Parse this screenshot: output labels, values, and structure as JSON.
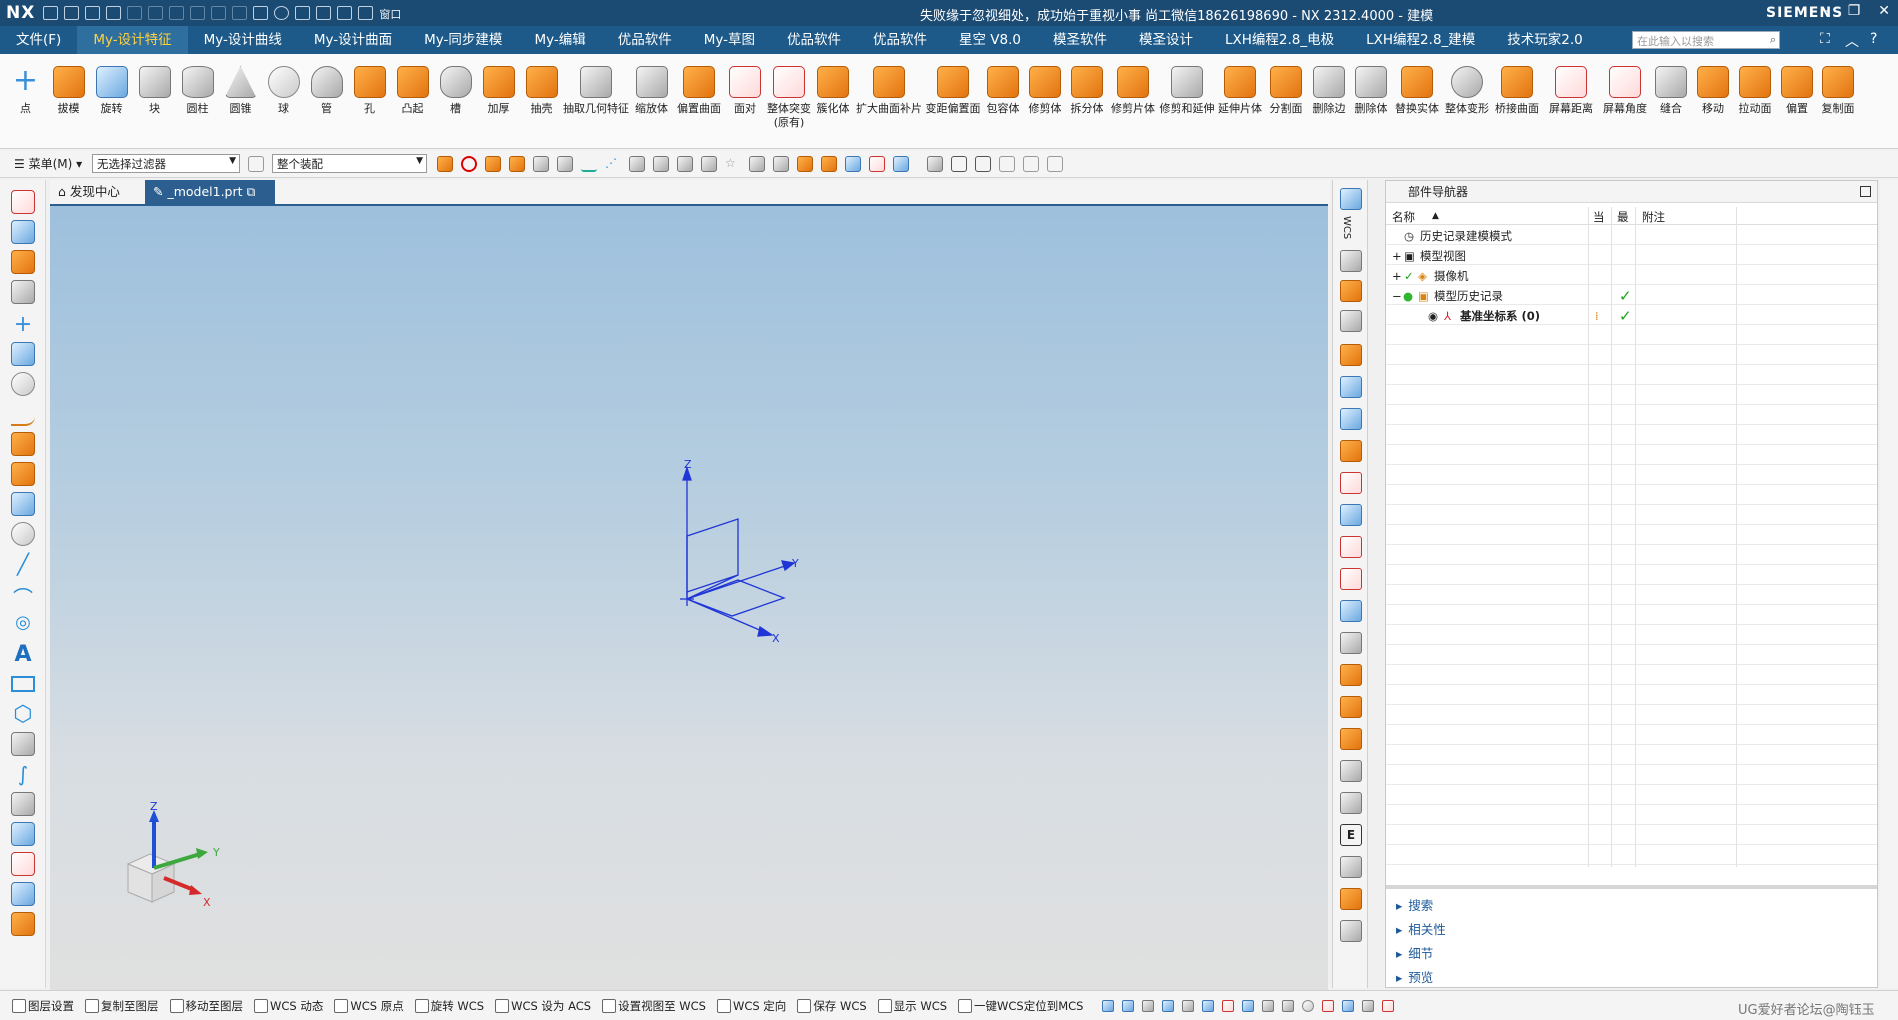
{
  "titlebar": {
    "logo": "NX",
    "title": "失败缘于忽视细处，成功始于重视小事   尚工微信18626198690 - NX 2312.4000 - 建模",
    "brand": "SIEMENS",
    "window_label": "窗口"
  },
  "menubar": {
    "items": [
      "文件(F)",
      "My-设计特征",
      "My-设计曲线",
      "My-设计曲面",
      "My-同步建模",
      "My-编辑",
      "优品软件",
      "My-草图",
      "优品软件",
      "优品软件",
      "星空 V8.0",
      "模圣软件",
      "模圣设计",
      "LXH编程2.8_电极",
      "LXH编程2.8_建模",
      "技术玩家2.0"
    ],
    "active_index": 1,
    "search_placeholder": "在此输入以搜索"
  },
  "ribbon": {
    "buttons": [
      {
        "label": "点",
        "icon": "point-icon"
      },
      {
        "label": "拔模",
        "icon": "draft-icon"
      },
      {
        "label": "旋转",
        "icon": "revolve-icon"
      },
      {
        "label": "块",
        "icon": "block-icon"
      },
      {
        "label": "圆柱",
        "icon": "cylinder-icon"
      },
      {
        "label": "圆锥",
        "icon": "cone-icon"
      },
      {
        "label": "球",
        "icon": "sphere-icon"
      },
      {
        "label": "管",
        "icon": "tube-icon"
      },
      {
        "label": "孔",
        "icon": "hole-icon"
      },
      {
        "label": "凸起",
        "icon": "emboss-icon"
      },
      {
        "label": "槽",
        "icon": "groove-icon"
      },
      {
        "label": "加厚",
        "icon": "thicken-icon"
      },
      {
        "label": "抽壳",
        "icon": "shell-icon"
      },
      {
        "label": "抽取几何特征",
        "icon": "extract-geometry-icon"
      },
      {
        "label": "缩放体",
        "icon": "scale-body-icon"
      },
      {
        "label": "偏置曲面",
        "icon": "offset-surface-icon"
      },
      {
        "label": "面对",
        "icon": "face-pair-icon"
      },
      {
        "label": "整体突变",
        "label2": "(原有)",
        "icon": "global-shaping-icon"
      },
      {
        "label": "簇化体",
        "icon": "cluster-body-icon"
      },
      {
        "label": "扩大曲面补片",
        "icon": "enlarge-patch-icon"
      },
      {
        "label": "变距偏置面",
        "icon": "variable-offset-icon"
      },
      {
        "label": "包容体",
        "icon": "bounding-body-icon"
      },
      {
        "label": "修剪体",
        "icon": "trim-body-icon"
      },
      {
        "label": "拆分体",
        "icon": "split-body-icon"
      },
      {
        "label": "修剪片体",
        "icon": "trim-sheet-icon"
      },
      {
        "label": "修剪和延伸",
        "icon": "trim-extend-icon"
      },
      {
        "label": "延伸片体",
        "icon": "extend-sheet-icon"
      },
      {
        "label": "分割面",
        "icon": "divide-face-icon"
      },
      {
        "label": "删除边",
        "icon": "delete-edge-icon"
      },
      {
        "label": "删除体",
        "icon": "delete-body-icon"
      },
      {
        "label": "替换实体",
        "icon": "replace-body-icon"
      },
      {
        "label": "整体变形",
        "icon": "global-deform-icon"
      },
      {
        "label": "桥接曲面",
        "icon": "bridge-surface-icon"
      },
      {
        "label": "屏幕距离",
        "icon": "screen-distance-icon"
      },
      {
        "label": "屏幕角度",
        "icon": "screen-angle-icon"
      },
      {
        "label": "缝合",
        "icon": "sew-icon"
      },
      {
        "label": "移动",
        "icon": "move-icon"
      },
      {
        "label": "拉动面",
        "icon": "pull-face-icon"
      },
      {
        "label": "偏置",
        "icon": "offset-icon"
      },
      {
        "label": "复制面",
        "icon": "copy-face-icon"
      }
    ]
  },
  "selbar": {
    "menu_label": "菜单(M)",
    "filter_value": "无选择过滤器",
    "scope_value": "整个装配"
  },
  "tabs": {
    "items": [
      {
        "label": "发现中心"
      },
      {
        "label": "_model1.prt"
      }
    ]
  },
  "viewport": {
    "datum_labels": {
      "x": "X",
      "y": "Y",
      "z": "Z"
    },
    "triad_labels": {
      "x": "X",
      "y": "Y",
      "z": "Z"
    }
  },
  "rightstrip": {
    "wcs_label": "WCS"
  },
  "navigator": {
    "title": "部件导航器",
    "columns": {
      "name": "名称",
      "current": "当",
      "latest": "最",
      "note": "附注"
    },
    "rows": [
      {
        "label": "历史记录建模模式",
        "latest_check": "",
        "icon": "history-clock-icon"
      },
      {
        "label": "模型视图",
        "latest_check": "",
        "icon": "model-views-icon"
      },
      {
        "label": "摄像机",
        "latest_check": "",
        "icon": "camera-icon"
      },
      {
        "label": "模型历史记录",
        "latest_check": "✓",
        "icon": "model-history-icon"
      },
      {
        "label": "基准坐标系 (0)",
        "latest_check": "✓",
        "icon": "datum-csys-icon"
      }
    ],
    "sections": [
      "搜索",
      "相关性",
      "细节",
      "预览"
    ]
  },
  "statusbar": {
    "items": [
      "图层设置",
      "复制至图层",
      "移动至图层",
      "WCS 动态",
      "WCS 原点",
      "旋转 WCS",
      "WCS 设为 ACS",
      "设置视图至 WCS",
      "WCS 定向",
      "保存 WCS",
      "显示 WCS",
      "一键WCS定位到MCS"
    ],
    "watermark": "UG爱好者论坛@陶钰玉"
  },
  "colors": {
    "titlebar": "#1b4a73",
    "menubar": "#1d5a89",
    "active_menu_text": "#ffd23c",
    "check": "#19a319",
    "datum_blue": "#1f35d6"
  }
}
